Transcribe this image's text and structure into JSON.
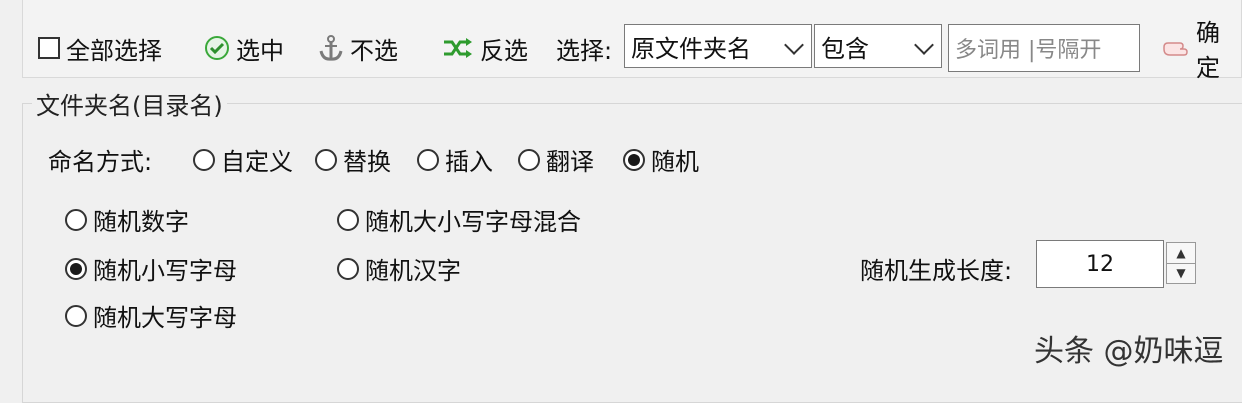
{
  "toolbar": {
    "select_all_label": "全部选择",
    "check_label": "选中",
    "uncheck_label": "不选",
    "invert_label": "反选",
    "select_prefix": "选择:",
    "field_select_value": "原文件夹名",
    "match_select_value": "包含",
    "keyword_placeholder": "多词用 |号隔开",
    "confirm_label": "确定"
  },
  "group": {
    "title": "文件夹名(目录名)",
    "naming_label": "命名方式:",
    "naming_options": [
      "自定义",
      "替换",
      "插入",
      "翻译",
      "随机"
    ],
    "naming_selected": "随机",
    "random_options": [
      "随机数字",
      "随机小写字母",
      "随机大写字母",
      "随机大小写字母混合",
      "随机汉字"
    ],
    "random_selected": "随机小写字母",
    "length_label": "随机生成长度:",
    "length_value": "12"
  },
  "watermark": "头条 @奶味逗",
  "colors": {
    "check_green": "#3aa83a",
    "invert_green": "#2e9b2e",
    "anchor_gray": "#7a7a7a"
  }
}
